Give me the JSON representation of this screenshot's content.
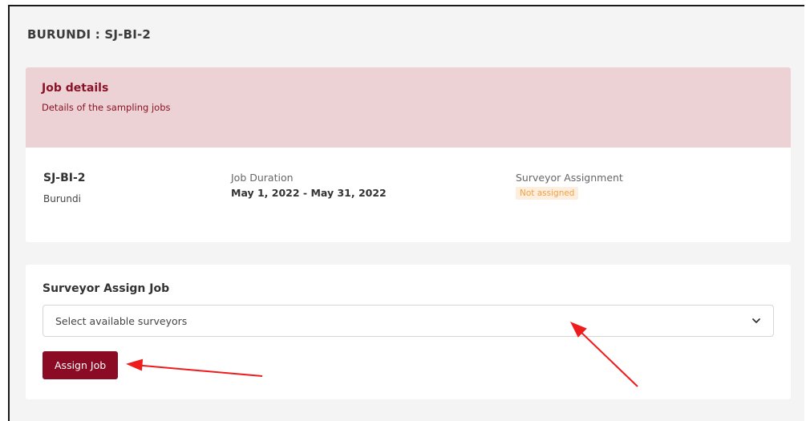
{
  "page": {
    "title": "BURUNDI : SJ-BI-2"
  },
  "job_details": {
    "heading": "Job details",
    "subheading": "Details of the sampling jobs",
    "code": "SJ-BI-2",
    "country": "Burundi",
    "duration_label": "Job Duration",
    "duration_value": "May 1, 2022 - May 31, 2022",
    "assignment_label": "Surveyor Assignment",
    "assignment_status": "Not assigned"
  },
  "assign": {
    "title": "Surveyor Assign Job",
    "select_placeholder": "Select available surveyors",
    "button_label": "Assign Job"
  },
  "colors": {
    "accent": "#8b0a24",
    "header_bg": "#ecd2d4",
    "badge_text": "#f0a14a",
    "annotation": "#ee1c1c"
  },
  "icons": {
    "select": "chevron-down-icon"
  }
}
